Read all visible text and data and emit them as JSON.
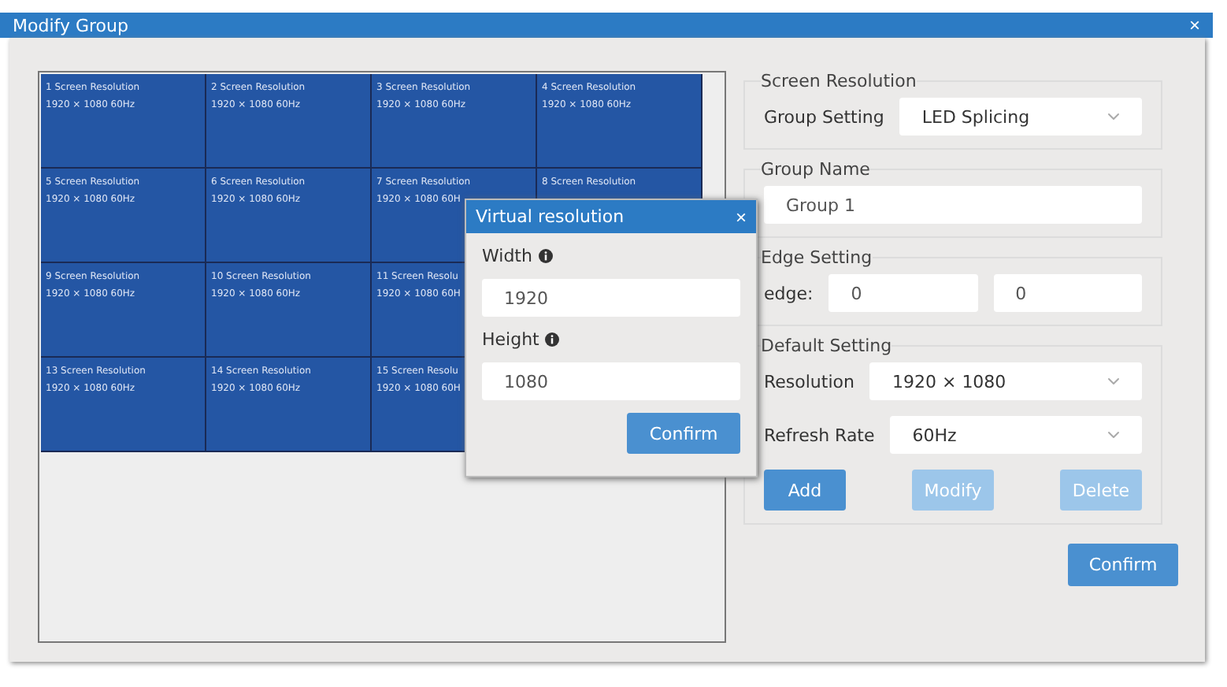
{
  "window": {
    "title": "Modify Group",
    "close": "×"
  },
  "canvas": {
    "rows": [
      [
        {
          "name": "1 Screen Resolution",
          "resolution": "1920 × 1080 60Hz"
        },
        {
          "name": "2 Screen Resolution",
          "resolution": "1920 × 1080 60Hz"
        },
        {
          "name": "3 Screen Resolution",
          "resolution": "1920 × 1080 60Hz"
        },
        {
          "name": "4 Screen Resolution",
          "resolution": "1920 × 1080 60Hz"
        }
      ],
      [
        {
          "name": "5 Screen Resolution",
          "resolution": "1920 × 1080 60Hz"
        },
        {
          "name": "6 Screen Resolution",
          "resolution": "1920 × 1080 60Hz"
        },
        {
          "name": "7 Screen Resolution",
          "resolution": "1920 × 1080 60H"
        },
        {
          "name": "8 Screen Resolution"
        }
      ],
      [
        {
          "name": "9 Screen Resolution",
          "resolution": "1920 × 1080 60Hz"
        },
        {
          "name": "10 Screen Resolution",
          "resolution": "1920 × 1080 60Hz"
        },
        {
          "name": "11 Screen Resolu",
          "resolution": "1920 × 1080 60H"
        }
      ],
      [
        {
          "name": "13 Screen Resolution",
          "resolution": "1920 × 1080 60Hz"
        },
        {
          "name": "14 Screen Resolution",
          "resolution": "1920 × 1080 60Hz"
        },
        {
          "name": "15 Screen Resolu",
          "resolution": "1920 × 1080 60H"
        }
      ]
    ]
  },
  "popup": {
    "title": "Virtual resolution",
    "close": "×",
    "fields": [
      {
        "label": "Width",
        "value": "1920"
      },
      {
        "label": "Height",
        "value": "1080"
      }
    ],
    "button": "Confirm"
  },
  "screen_resolution": {
    "legend": "Screen Resolution",
    "label": "Group Setting",
    "value": "LED Splicing"
  },
  "group_name": {
    "legend": "Group Name",
    "value": "Group 1"
  },
  "edge_setting": {
    "legend": "Edge Setting",
    "label": "edge:",
    "values": [
      "0",
      "0"
    ]
  },
  "default_setting": {
    "legend": "Default Setting",
    "selects": [
      {
        "label": "Resolution",
        "value": "1920 × 1080"
      },
      {
        "label": "Refresh Rate",
        "value": "60Hz"
      }
    ],
    "buttons": [
      {
        "label": "Add",
        "disabled": false
      },
      {
        "label": "Modify",
        "disabled": true
      },
      {
        "label": "Delete",
        "disabled": true
      }
    ]
  },
  "confirm": "Confirm"
}
